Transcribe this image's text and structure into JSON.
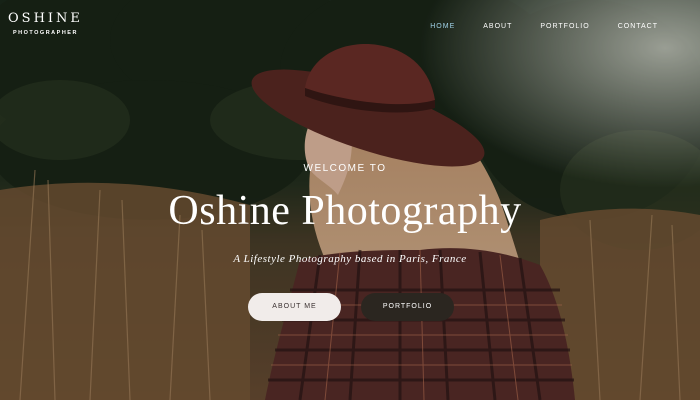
{
  "brand": {
    "name": "OSHINE",
    "tagline": "PHOTOGRAPHER"
  },
  "nav": {
    "items": [
      {
        "label": "HOME",
        "active": true
      },
      {
        "label": "ABOUT",
        "active": false
      },
      {
        "label": "PORTFOLIO",
        "active": false
      },
      {
        "label": "CONTACT",
        "active": false
      }
    ]
  },
  "hero": {
    "kicker": "WELCOME TO",
    "title": "Oshine Photography",
    "subtitle": "A Lifestyle Photography based in Paris, France",
    "buttons": {
      "about": "ABOUT ME",
      "portfolio": "PORTFOLIO"
    }
  },
  "colors": {
    "nav_active": "#9fd0e6",
    "btn_light": "#f1ecea",
    "btn_dark": "#2b2620"
  }
}
